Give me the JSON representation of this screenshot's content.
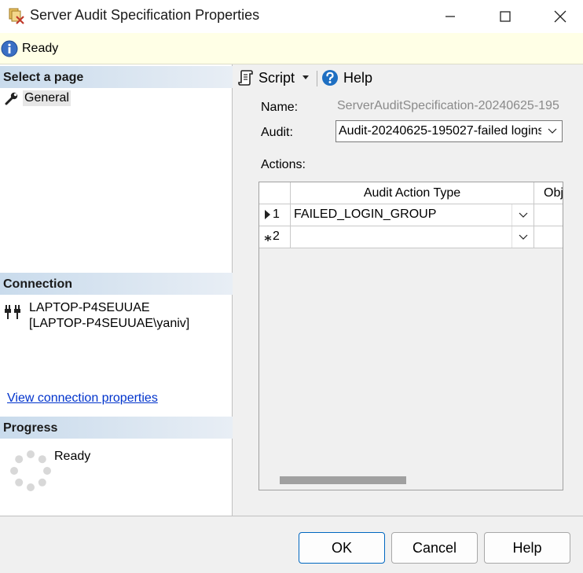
{
  "window": {
    "title": "Server Audit Specification Properties"
  },
  "status": {
    "text": "Ready"
  },
  "left": {
    "select_page_header": "Select a page",
    "pages": [
      {
        "label": "General"
      }
    ],
    "connection_header": "Connection",
    "connection_server": "LAPTOP-P4SEUUAE",
    "connection_user": "[LAPTOP-P4SEUUAE\\yaniv]",
    "view_connection_link": "View connection properties",
    "progress_header": "Progress",
    "progress_status": "Ready"
  },
  "toolbar": {
    "script_label": "Script",
    "help_label": "Help"
  },
  "form": {
    "name_label": "Name:",
    "name_value": "ServerAuditSpecification-20240625-195",
    "audit_label": "Audit:",
    "audit_value": "Audit-20240625-195027-failed logins",
    "actions_label": "Actions:"
  },
  "grid": {
    "columns": [
      "Audit Action Type",
      "Obj"
    ],
    "rows": [
      {
        "marker": "current-row",
        "number": "1",
        "action_type": "FAILED_LOGIN_GROUP"
      },
      {
        "marker": "new-row",
        "number": "2",
        "action_type": ""
      }
    ]
  },
  "buttons": {
    "ok": "OK",
    "cancel": "Cancel",
    "help": "Help"
  },
  "colors": {
    "accent": "#0067c0",
    "link": "#0033cc",
    "status_bg": "#ffffe6",
    "section_header": "#c9dbec"
  }
}
